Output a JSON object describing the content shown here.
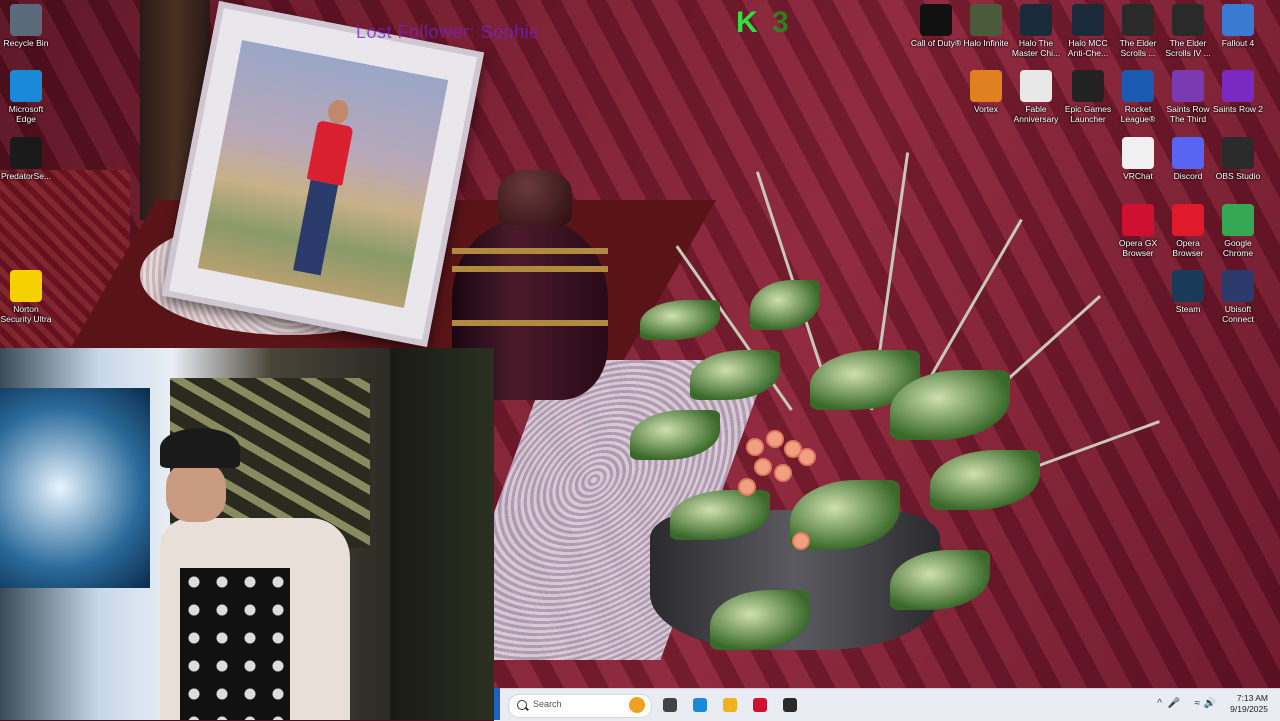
{
  "overlay": {
    "title": "Lost Follower: Sophie",
    "logo_k": "K",
    "logo_num": "3"
  },
  "desktop_icons": [
    {
      "id": "recycle-bin",
      "label": "Recycle Bin",
      "icon": "recycle-bin-icon",
      "color": "#5a6a7a"
    },
    {
      "id": "microsoft-edge",
      "label": "Microsoft Edge",
      "icon": "edge-icon",
      "color": "#1a8ad8"
    },
    {
      "id": "predatorsense",
      "label": "PredatorSe...",
      "icon": "predator-icon",
      "color": "#1a1a1a"
    },
    {
      "id": "norton",
      "label": "Norton Security Ultra",
      "icon": "norton-icon",
      "color": "#f4d000"
    },
    {
      "id": "call-of-duty",
      "label": "Call of Duty®",
      "icon": "cod-icon",
      "color": "#111111"
    },
    {
      "id": "halo-infinite",
      "label": "Halo Infinite",
      "icon": "halo-icon",
      "color": "#4a5a3a"
    },
    {
      "id": "halo-mcc",
      "label": "Halo The Master Chi...",
      "icon": "halo-mcc-icon",
      "color": "#1a2a3a"
    },
    {
      "id": "halo-anticheat",
      "label": "Halo MCC Anti-Che...",
      "icon": "halo-ac-icon",
      "color": "#1a2a3a"
    },
    {
      "id": "elder-scrolls-5",
      "label": "The Elder Scrolls ...",
      "icon": "skyrim-icon",
      "color": "#2a2a2a"
    },
    {
      "id": "elder-scrolls-4",
      "label": "The Elder Scrolls IV ...",
      "icon": "oblivion-icon",
      "color": "#2a2a2a"
    },
    {
      "id": "fallout-4",
      "label": "Fallout 4",
      "icon": "fallout-icon",
      "color": "#3a7ad0"
    },
    {
      "id": "vortex",
      "label": "Vortex",
      "icon": "vortex-icon",
      "color": "#e08020"
    },
    {
      "id": "fable",
      "label": "Fable Anniversary",
      "icon": "fable-icon",
      "color": "#e8e8e8"
    },
    {
      "id": "epic",
      "label": "Epic Games Launcher",
      "icon": "epic-icon",
      "color": "#222222"
    },
    {
      "id": "rocket-league",
      "label": "Rocket League®",
      "icon": "rocket-league-icon",
      "color": "#1a5ab0"
    },
    {
      "id": "saints-row-3",
      "label": "Saints Row The Third",
      "icon": "saints-row-3-icon",
      "color": "#7a3ab0"
    },
    {
      "id": "saints-row-2",
      "label": "Saints Row 2",
      "icon": "saints-row-2-icon",
      "color": "#7a2ac0"
    },
    {
      "id": "vrchat",
      "label": "VRChat",
      "icon": "vrchat-icon",
      "color": "#f0f0f0"
    },
    {
      "id": "discord",
      "label": "Discord",
      "icon": "discord-icon",
      "color": "#5865f2"
    },
    {
      "id": "obs",
      "label": "OBS Studio",
      "icon": "obs-icon",
      "color": "#2a2a2a"
    },
    {
      "id": "opera-gx",
      "label": "Opera GX Browser",
      "icon": "opera-gx-icon",
      "color": "#d01030"
    },
    {
      "id": "opera",
      "label": "Opera Browser",
      "icon": "opera-icon",
      "color": "#e01a2a"
    },
    {
      "id": "chrome",
      "label": "Google Chrome",
      "icon": "chrome-icon",
      "color": "#34a853"
    },
    {
      "id": "steam",
      "label": "Steam",
      "icon": "steam-icon",
      "color": "#1a3a5a"
    },
    {
      "id": "ubisoft",
      "label": "Ubisoft Connect",
      "icon": "ubisoft-icon",
      "color": "#2a3a6a"
    }
  ],
  "taskbar": {
    "search_placeholder": "Search",
    "pinned": [
      {
        "id": "task-view",
        "icon": "task-view-icon",
        "color": "#444444"
      },
      {
        "id": "edge",
        "icon": "edge-icon",
        "color": "#1a8ad8"
      },
      {
        "id": "file-explorer",
        "icon": "folder-icon",
        "color": "#f0b020"
      },
      {
        "id": "opera-gx",
        "icon": "opera-gx-icon",
        "color": "#d01030"
      },
      {
        "id": "obs",
        "icon": "obs-icon",
        "color": "#2a2a2a"
      }
    ],
    "time": "7:13 AM",
    "date": "9/19/2025"
  }
}
